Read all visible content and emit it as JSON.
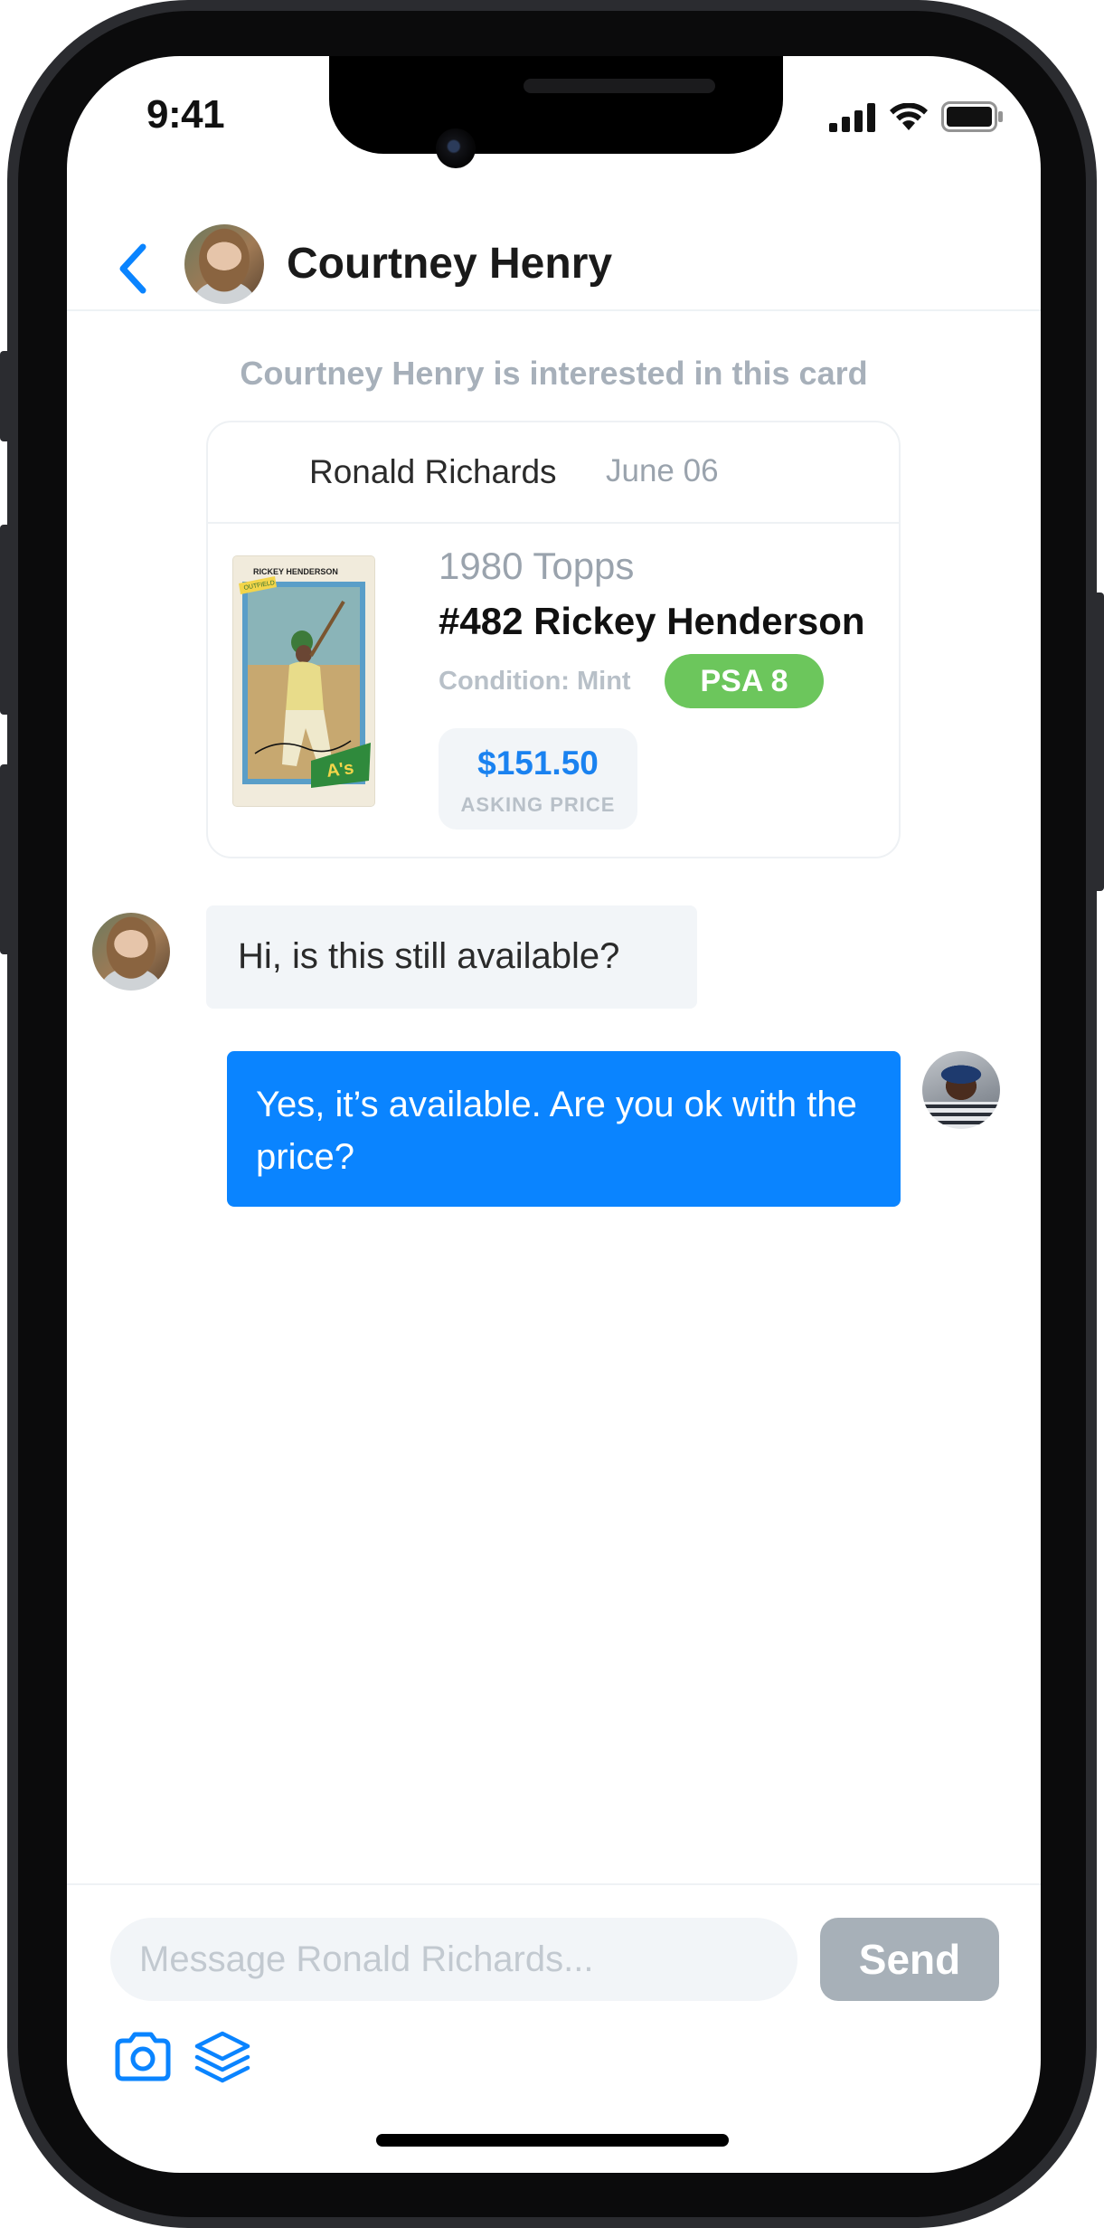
{
  "status_bar": {
    "time": "9:41"
  },
  "header": {
    "contact_name": "Courtney Henry"
  },
  "conversation": {
    "system_note": "Courtney Henry is interested in this card",
    "card": {
      "seller": "Ronald Richards",
      "date": "June 06",
      "set": "1980 Topps",
      "title": "#482 Rickey Henderson",
      "condition": "Condition: Mint",
      "grade": "PSA 8",
      "price": "$151.50",
      "price_label": "ASKING PRICE",
      "image_lettering": [
        "RICKEY HENDERSON",
        "OUTFIELD",
        "A's"
      ]
    },
    "messages": [
      {
        "direction": "incoming",
        "text": "Hi, is this still available?"
      },
      {
        "direction": "outgoing",
        "text": "Yes, it’s available. Are you ok with the price?"
      }
    ]
  },
  "composer": {
    "placeholder": "Message Ronald Richards...",
    "send_label": "Send",
    "tools": [
      "camera-icon",
      "layers-icon"
    ]
  },
  "colors": {
    "accent": "#0a84ff",
    "grade_badge": "#6cc65c",
    "send_disabled": "#a7b0b8",
    "muted_text": "#a7b0ba",
    "incoming_bubble": "#f2f5f8"
  }
}
